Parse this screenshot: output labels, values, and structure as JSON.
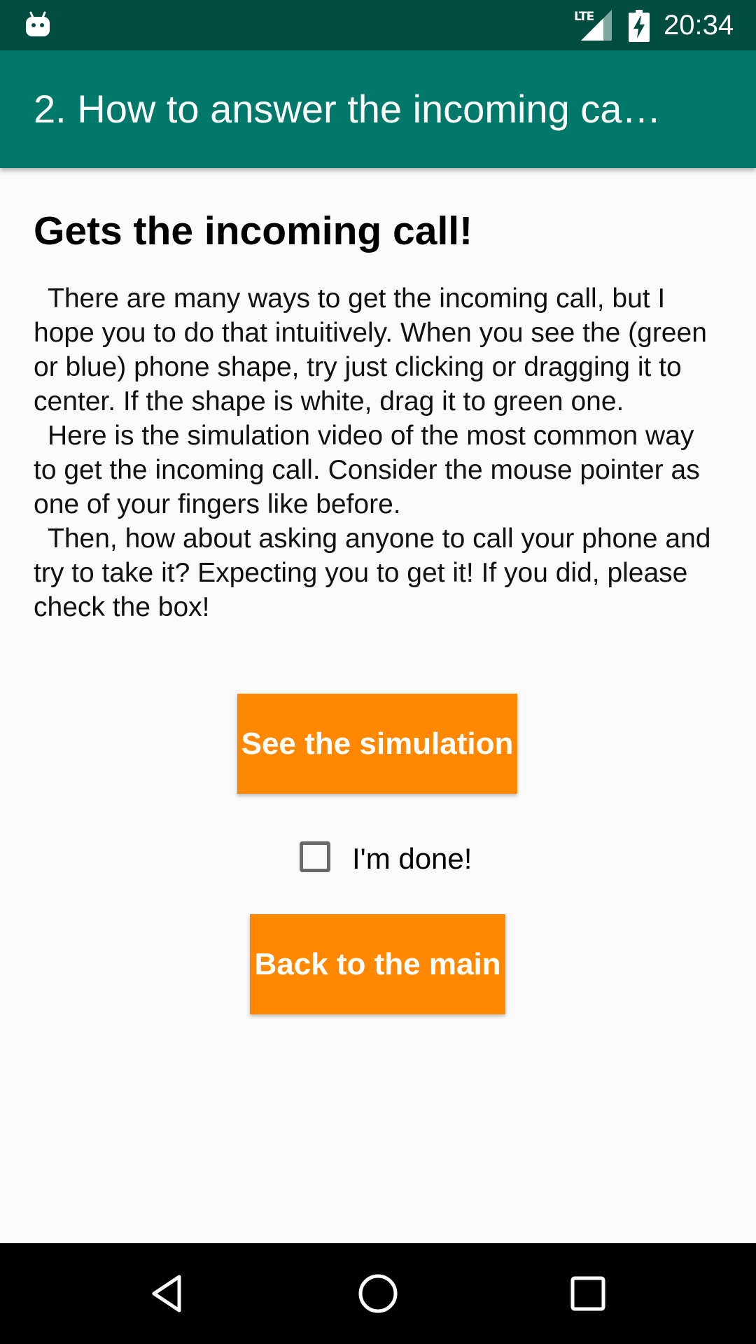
{
  "status_bar": {
    "notification_icon": "android-robot-icon",
    "network": "LTE",
    "battery_icon": "battery-charging-icon",
    "time": "20:34"
  },
  "app_bar": {
    "title": "2. How to answer the incoming ca…"
  },
  "content": {
    "heading": "Gets the incoming call!",
    "paragraphs": [
      "There are many ways to get the incoming call, but I hope you to do that intuitively. When you see the (green or blue) phone shape, try just clicking or dragging it to center. If the shape is white, drag it to green one.",
      "Here is the simulation video of the most common way to get the incoming call. Consider the mouse pointer as one of your fingers like before.",
      "Then, how about asking anyone to call your phone and try to take it? Expecting you to get it! If you did, please check the box!"
    ],
    "simulation_button": "See the simulation",
    "done_checkbox": {
      "label": "I'm done!",
      "checked": false
    },
    "back_button": "Back to the main"
  },
  "nav_bar": {
    "back_icon": "back-triangle-icon",
    "home_icon": "home-circle-icon",
    "recents_icon": "recents-square-icon"
  },
  "colors": {
    "status_bar": "#004d40",
    "app_bar": "#00796b",
    "button": "#ff8800",
    "background": "#fafafa"
  }
}
